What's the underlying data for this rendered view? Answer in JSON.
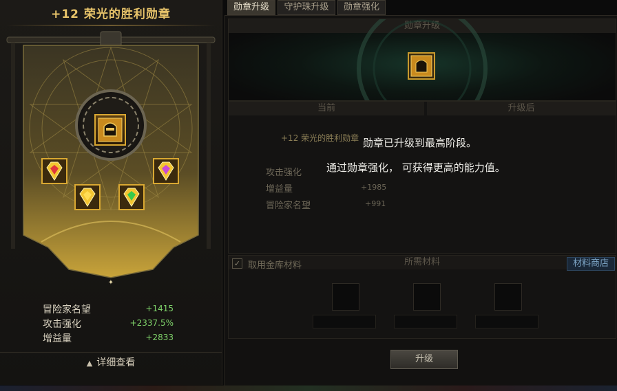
{
  "left_panel": {
    "title": "+12 荣光的胜利勋章",
    "stats": [
      {
        "label": "冒险家名望",
        "value": "+1415"
      },
      {
        "label": "攻击强化",
        "value": "+2337.5%"
      },
      {
        "label": "增益量",
        "value": "+2833"
      }
    ],
    "detail_button": "详细查看"
  },
  "tabs": [
    {
      "label": "勋章升级",
      "active": true
    },
    {
      "label": "守护珠升级",
      "active": false
    },
    {
      "label": "勋章强化",
      "active": false
    }
  ],
  "right_panel": {
    "upgrade_header": "勋章升级",
    "current_header": "当前",
    "after_header": "升级后",
    "current_item": "+12 荣光的胜利勋章",
    "stats": [
      {
        "label": "攻击强化",
        "value": ""
      },
      {
        "label": "增益量",
        "value": "+1985"
      },
      {
        "label": "冒险家名望",
        "value": "+991"
      }
    ],
    "message_line1": "勋章已升级到最高阶段。",
    "message_line2": "通过勋章强化， 可获得更高的能力值。",
    "materials": {
      "vault_checkbox_label": "取用金库材料",
      "header": "所需材料",
      "shop_button": "材料商店"
    },
    "upgrade_button": "升级"
  },
  "colors": {
    "gold": "#e8c46a",
    "stat_green": "#7fd36a",
    "gem_red": "#e0353b",
    "gem_green": "#37c94c",
    "gem_purple": "#c94ad6",
    "gem_yellow": "#f3c531"
  }
}
